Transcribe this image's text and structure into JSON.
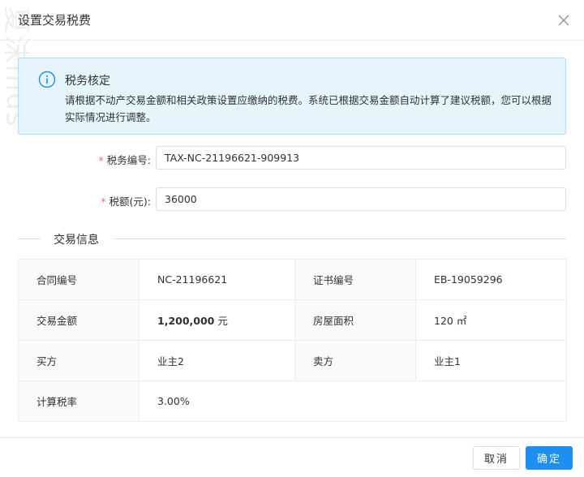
{
  "dialog": {
    "title": "设置交易税费",
    "watermark": "夏沫mds"
  },
  "alert": {
    "title": "税务核定",
    "text": "请根据不动产交易金额和相关政策设置应缴纳的税费。系统已根据交易金额自动计算了建议税额，您可以根据实际情况进行调整。"
  },
  "form": {
    "tax_number": {
      "required_mark": "*",
      "label": "税务编号:",
      "value": "TAX-NC-21196621-909913"
    },
    "tax_amount": {
      "required_mark": "*",
      "label": "税额(元):",
      "value": "36000"
    }
  },
  "section": {
    "title": "交易信息"
  },
  "info": {
    "rows": [
      [
        {
          "label": "合同编号",
          "value": "NC-21196621"
        },
        {
          "label": "证书编号",
          "value": "EB-19059296"
        }
      ],
      [
        {
          "label": "交易金额",
          "value": "1,200,000",
          "unit": " 元"
        },
        {
          "label": "房屋面积",
          "value": "120 ㎡"
        }
      ],
      [
        {
          "label": "买方",
          "value": "业主2"
        },
        {
          "label": "卖方",
          "value": "业主1"
        }
      ],
      [
        {
          "label": "计算税率",
          "value": "3.00%"
        }
      ]
    ]
  },
  "footer": {
    "cancel_label": "取消",
    "ok_label": "确定"
  },
  "colors": {
    "primary": "#1e8ff0",
    "alert_bg": "#e6f4fc",
    "alert_border": "#a9dbf3",
    "required": "#f56c6c"
  },
  "icons": {
    "close": "close-icon",
    "info": "info-circle-icon"
  }
}
